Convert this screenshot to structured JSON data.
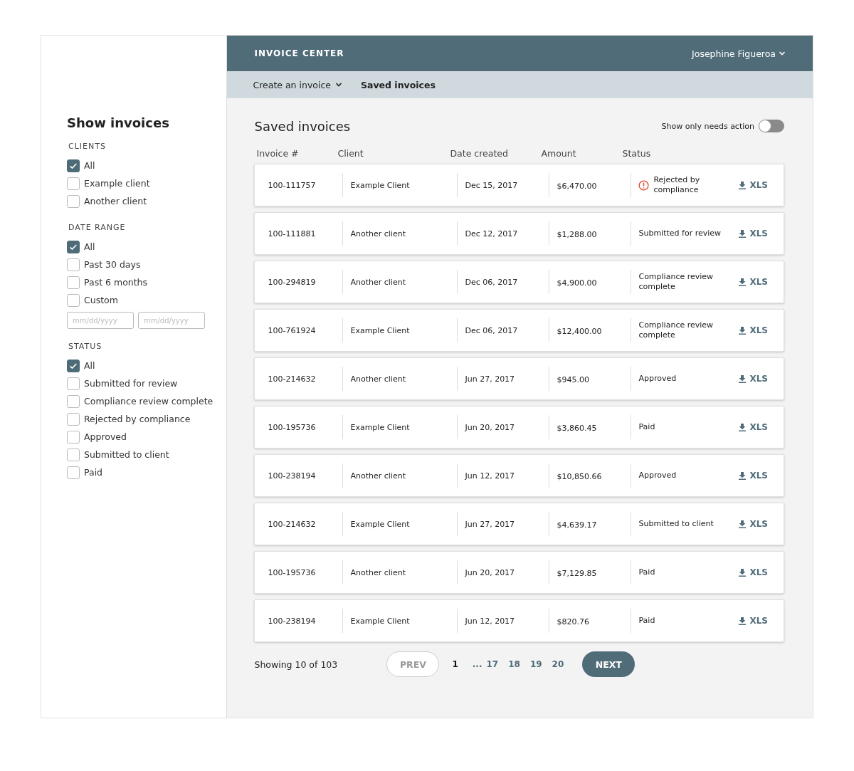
{
  "sidebar": {
    "title": "Show invoices",
    "groups": [
      {
        "heading": "CLIENTS",
        "options": [
          {
            "label": "All",
            "checked": true
          },
          {
            "label": "Example client",
            "checked": false
          },
          {
            "label": "Another client",
            "checked": false
          }
        ]
      },
      {
        "heading": "DATE RANGE",
        "options": [
          {
            "label": "All",
            "checked": true
          },
          {
            "label": "Past 30 days",
            "checked": false
          },
          {
            "label": "Past 6 months",
            "checked": false
          },
          {
            "label": "Custom",
            "checked": false
          }
        ],
        "date_fields": [
          {
            "placeholder": "mm/dd/yyyy"
          },
          {
            "placeholder": "mm/dd/yyyy"
          }
        ]
      },
      {
        "heading": "STATUS",
        "options": [
          {
            "label": "All",
            "checked": true
          },
          {
            "label": "Submitted for review",
            "checked": false
          },
          {
            "label": "Compliance review complete",
            "checked": false
          },
          {
            "label": "Rejected by compliance",
            "checked": false
          },
          {
            "label": "Approved",
            "checked": false
          },
          {
            "label": "Submitted to client",
            "checked": false
          },
          {
            "label": "Paid",
            "checked": false
          }
        ]
      }
    ]
  },
  "header": {
    "title": "INVOICE CENTER",
    "user": "Josephine Figueroa"
  },
  "subnav": [
    {
      "label": "Create an invoice",
      "dropdown": true,
      "selected": false
    },
    {
      "label": "Saved invoices",
      "dropdown": false,
      "selected": true
    }
  ],
  "main": {
    "title": "Saved invoices",
    "toggle": {
      "label": "Show only needs action",
      "on": false
    }
  },
  "table": {
    "columns": [
      "Invoice #",
      "Client",
      "Date created",
      "Amount",
      "Status"
    ],
    "rows": [
      {
        "invoice": "100-111757",
        "client": "Example Client",
        "date": "Dec 15, 2017",
        "amount": "$6,470.00",
        "status": "Rejected by compliance",
        "alert": true,
        "download": "XLS"
      },
      {
        "invoice": "100-111881",
        "client": "Another client",
        "date": "Dec 12, 2017",
        "amount": "$1,288.00",
        "status": "Submitted for review",
        "alert": false,
        "download": "XLS"
      },
      {
        "invoice": "100-294819",
        "client": "Another client",
        "date": "Dec 06, 2017",
        "amount": "$4,900.00",
        "status": "Compliance review complete",
        "alert": false,
        "download": "XLS"
      },
      {
        "invoice": "100-761924",
        "client": "Example Client",
        "date": "Dec 06, 2017",
        "amount": "$12,400.00",
        "status": "Compliance review complete",
        "alert": false,
        "download": "XLS"
      },
      {
        "invoice": "100-214632",
        "client": "Another client",
        "date": "Jun 27, 2017",
        "amount": "$945.00",
        "status": "Approved",
        "alert": false,
        "download": "XLS"
      },
      {
        "invoice": "100-195736",
        "client": "Example Client",
        "date": "Jun 20, 2017",
        "amount": "$3,860.45",
        "status": "Paid",
        "alert": false,
        "download": "XLS"
      },
      {
        "invoice": "100-238194",
        "client": "Another client",
        "date": "Jun 12, 2017",
        "amount": "$10,850.66",
        "status": "Approved",
        "alert": false,
        "download": "XLS"
      },
      {
        "invoice": "100-214632",
        "client": "Example Client",
        "date": "Jun 27, 2017",
        "amount": "$4,639.17",
        "status": "Submitted to client",
        "alert": false,
        "download": "XLS"
      },
      {
        "invoice": "100-195736",
        "client": "Another client",
        "date": "Jun 20, 2017",
        "amount": "$7,129.85",
        "status": "Paid",
        "alert": false,
        "download": "XLS"
      },
      {
        "invoice": "100-238194",
        "client": "Example Client",
        "date": "Jun 12, 2017",
        "amount": "$820.76",
        "status": "Paid",
        "alert": false,
        "download": "XLS"
      }
    ]
  },
  "footer": {
    "summary": "Showing 10 of 103",
    "prev": {
      "label": "PREV",
      "disabled": true
    },
    "next": {
      "label": "NEXT",
      "disabled": false
    },
    "pages": [
      {
        "label": "1",
        "kind": "page",
        "selected": true
      },
      {
        "label": "...",
        "kind": "ellipsis"
      },
      {
        "label": "17",
        "kind": "page",
        "selected": false
      },
      {
        "label": "18",
        "kind": "page",
        "selected": false
      },
      {
        "label": "19",
        "kind": "page",
        "selected": false
      },
      {
        "label": "20",
        "kind": "page",
        "selected": false
      }
    ]
  }
}
